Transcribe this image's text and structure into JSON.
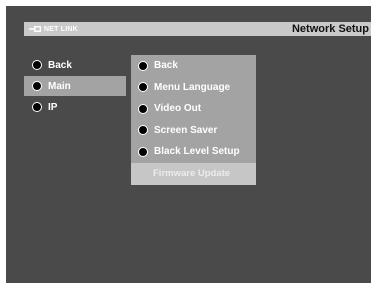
{
  "header": {
    "brand_label": "NET LINK",
    "title": "Network Setup"
  },
  "left_menu": {
    "items": [
      {
        "label": "Back",
        "selected": false
      },
      {
        "label": "Main",
        "selected": true
      },
      {
        "label": "IP",
        "selected": false
      }
    ]
  },
  "submenu": {
    "items": [
      {
        "label": "Back",
        "enabled": true
      },
      {
        "label": "Menu Language",
        "enabled": true
      },
      {
        "label": "Video Out",
        "enabled": true
      },
      {
        "label": "Screen Saver",
        "enabled": true
      },
      {
        "label": "Black Level Setup",
        "enabled": true
      },
      {
        "label": "Firmware Update",
        "enabled": false
      }
    ]
  },
  "colors": {
    "screen_background": "#4a4a4a",
    "title_bar": "#c9c9c9",
    "highlight": "#a3a3a3",
    "disabled_row": "#c6c6c6",
    "text": "#ffffff"
  }
}
